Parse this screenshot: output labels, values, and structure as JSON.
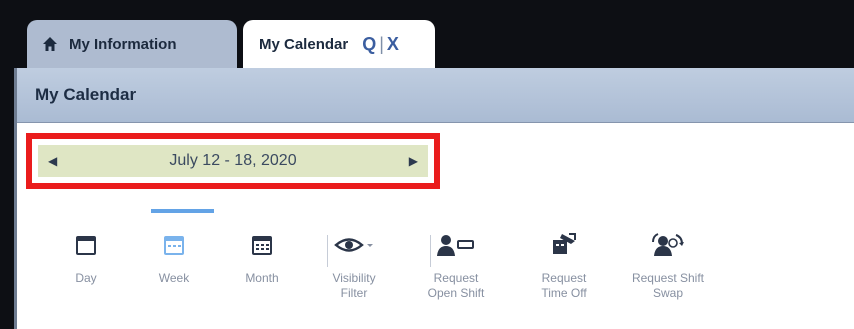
{
  "tabs": {
    "my_information": "My Information",
    "my_calendar": "My Calendar",
    "search_glyph": "Q",
    "separator": "|",
    "close_glyph": "X"
  },
  "panel": {
    "title": "My Calendar"
  },
  "date_range": {
    "label": "July 12 - 18, 2020",
    "prev": "◀",
    "next": "▶"
  },
  "toolbar": {
    "day": "Day",
    "week": "Week",
    "month": "Month",
    "visibility": "Visibility\nFilter",
    "open_shift": "Request\nOpen Shift",
    "time_off": "Request\nTime Off",
    "shift_swap": "Request Shift\nSwap"
  },
  "icons": {
    "home": "home-icon",
    "day": "calendar-day-icon",
    "week": "calendar-week-icon",
    "month": "calendar-month-icon",
    "eye": "eye-icon",
    "open_shift": "user-request-icon",
    "time_off": "time-off-icon",
    "shift_swap": "shift-swap-icon"
  },
  "colors": {
    "date_bar_bg": "#dfe6c4",
    "highlight": "#ea1c1c",
    "selected_underline": "#63a3e6"
  }
}
